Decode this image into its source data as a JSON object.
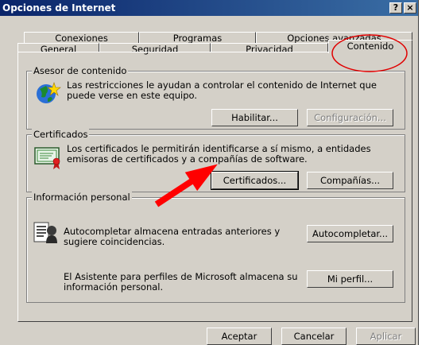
{
  "window": {
    "title": "Opciones de Internet",
    "help_button": "?",
    "close_button": "×"
  },
  "tabs": [
    {
      "label": "Conexiones"
    },
    {
      "label": "Programas"
    },
    {
      "label": "Opciones avanzadas"
    },
    {
      "label": "General"
    },
    {
      "label": "Seguridad"
    },
    {
      "label": "Privacidad"
    },
    {
      "label": "Contenido",
      "selected": true
    }
  ],
  "content_advisor": {
    "title": "Asesor de contenido",
    "description": "Las restricciones le ayudan a controlar el contenido de Internet que puede verse en este equipo.",
    "enable_button": "Habilitar...",
    "settings_button": "Configuración..."
  },
  "certificates": {
    "title": "Certificados",
    "description": "Los certificados le permitirán identificarse a sí mismo, a entidades emisoras de certificados y a compañías de software.",
    "certificates_button": "Certificados...",
    "publishers_button": "Compañías..."
  },
  "personal_info": {
    "title": "Información personal",
    "autocomplete_text": "Autocompletar almacena entradas anteriores y sugiere coincidencias.",
    "autocomplete_button": "Autocompletar...",
    "profile_text": "El Asistente para perfiles de Microsoft almacena su información personal.",
    "profile_button": "Mi perfil..."
  },
  "footer": {
    "ok_button": "Aceptar",
    "cancel_button": "Cancelar",
    "apply_button": "Aplicar"
  },
  "annotations": {
    "circle_color": "#e00000",
    "arrow_color": "#ff0000"
  }
}
